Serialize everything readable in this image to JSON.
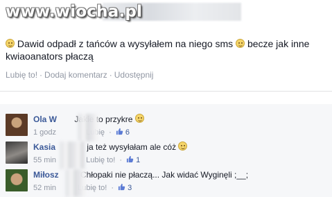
{
  "watermark": "www.wiocha.pl",
  "post": {
    "text_part1": "Dawid odpadł z tańców a wysyłałem na niego sms",
    "text_part2": "becze jak inne kwiaoanators płaczą",
    "actions": [
      "Lubię to!",
      "Dodaj komentarz",
      "Udostępnij"
    ],
    "separator": "·"
  },
  "comments": [
    {
      "name": "Ola W",
      "text": "Jakie to przykre",
      "time": "1 godz",
      "like_label": "Lubię",
      "likes": "6",
      "emoji": true
    },
    {
      "name": "Kasia",
      "text": "ja też wysyłałam ale cóż",
      "time": "55 min",
      "like_label": "Lubię to!",
      "likes": "1",
      "emoji": true
    },
    {
      "name": "Miłosz",
      "text": "Chłopaki nie płaczą... Jak widać Wyginęli ;__;",
      "time": "52 min",
      "like_label": "Lubię to!",
      "likes": "3",
      "emoji": false
    }
  ],
  "colors": {
    "link": "#3b5998",
    "meta": "#9197a3",
    "comment_bg": "#f6f7f9"
  }
}
